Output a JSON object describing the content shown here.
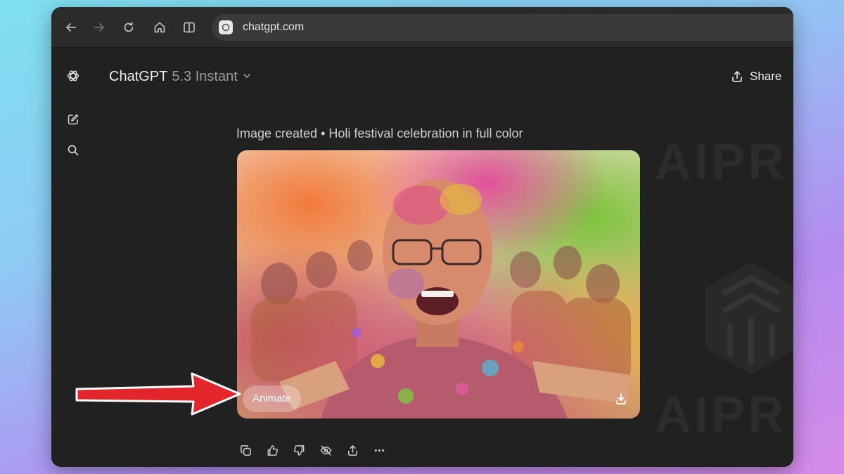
{
  "browser": {
    "url": "chatgpt.com",
    "icons": [
      "back-icon",
      "forward-icon",
      "reload-icon",
      "home-icon",
      "split-view-icon",
      "site-icon"
    ]
  },
  "header": {
    "model_name": "ChatGPT",
    "model_version": "5.3 Instant",
    "share_label": "Share"
  },
  "sidebar": {
    "icons": [
      "chatgpt-logo-icon",
      "new-chat-icon",
      "search-icon"
    ]
  },
  "message": {
    "caption": "Image created • Holi festival celebration in full color",
    "animate_label": "Animate",
    "image_alt": "Holi festival celebration in full color",
    "actions": [
      "copy-icon",
      "thumbs-up-icon",
      "thumbs-down-icon",
      "hide-icon",
      "share-icon",
      "more-icon"
    ]
  },
  "watermark": {
    "text": "AIPR"
  },
  "colors": {
    "window_bg": "#212121",
    "toolbar_bg": "#2b2b2b",
    "arrow": "#e3262b"
  }
}
